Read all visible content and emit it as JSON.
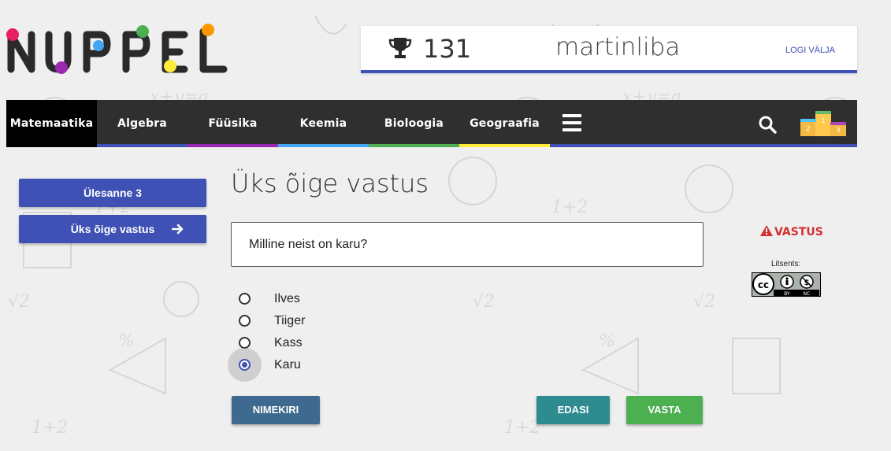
{
  "logo": {
    "text": "NUPPEL"
  },
  "user": {
    "points": "131",
    "username": "martinliba",
    "logout_label": "LOGI VÄLJA",
    "trophy_icon": "trophy-icon"
  },
  "nav": {
    "items": [
      {
        "label": "Matemaatika",
        "active": true,
        "stripe": "#000000"
      },
      {
        "label": "Algebra",
        "stripe": "#3f51b5"
      },
      {
        "label": "Füüsika",
        "stripe": "#9c27b0"
      },
      {
        "label": "Keemia",
        "stripe": "#42a5f5"
      },
      {
        "label": "Bioloogia",
        "stripe": "#4caf50"
      },
      {
        "label": "Geograafia",
        "stripe": "#ffeb3b"
      }
    ],
    "menu_icon": "hamburger-menu-icon",
    "search_icon": "search-icon",
    "podium_icon": "leaderboard-podium-icon",
    "podium": {
      "first": "1",
      "second": "2",
      "third": "3"
    }
  },
  "sidebar": {
    "task_label": "Ülesanne 3",
    "type_label": "Üks õige vastus",
    "arrow_icon": "arrow-right-icon"
  },
  "main": {
    "heading": "Üks õige vastus",
    "question": "Milline neist on karu?",
    "options": [
      {
        "label": "Ilves",
        "checked": false
      },
      {
        "label": "Tiiger",
        "checked": false
      },
      {
        "label": "Kass",
        "checked": false
      },
      {
        "label": "Karu",
        "checked": true
      }
    ],
    "list_button": "NIMEKIRI",
    "next_button": "EDASI",
    "answer_button": "VASTA"
  },
  "aside": {
    "answer_link": "VASTUS",
    "warning_icon": "warning-triangle-icon",
    "license_label": "Litsents:",
    "cc_by": "BY",
    "cc_nc": "NC"
  },
  "colors": {
    "primary": "#3f51b5",
    "nav_bg": "#2f2f2f",
    "next_button": "#2e8b90",
    "answer_button": "#4caf50",
    "list_button": "#3d6a8e",
    "danger": "#d32f2f"
  }
}
